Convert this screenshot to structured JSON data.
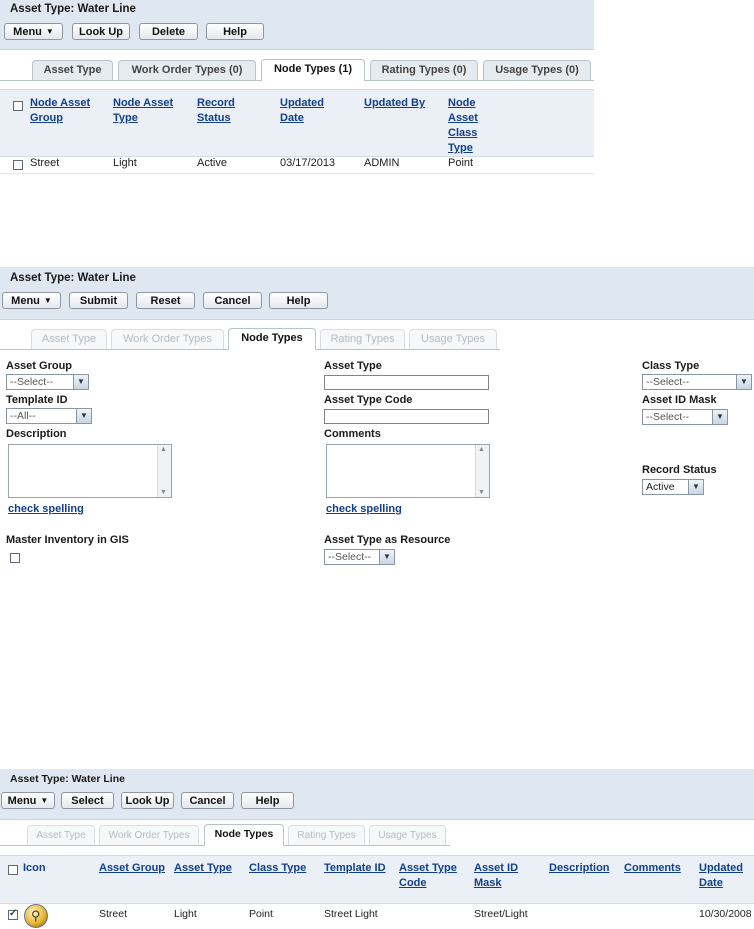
{
  "panel1": {
    "title": "Asset Type: Water Line",
    "buttons": {
      "menu": "Menu",
      "lookup": "Look Up",
      "delete": "Delete",
      "help": "Help"
    },
    "tabs": [
      "Asset Type",
      "Work Order Types (0)",
      "Node Types (1)",
      "Rating Types (0)",
      "Usage Types (0)"
    ],
    "active_tab": "Node Types (1)",
    "columns": {
      "c1": [
        "Node Asset",
        "Group"
      ],
      "c2": [
        "Node Asset",
        "Type"
      ],
      "c3": [
        "Record",
        "Status"
      ],
      "c4": [
        "Updated",
        "Date"
      ],
      "c5": [
        "Updated By"
      ],
      "c6": [
        "Node",
        "Asset",
        "Class",
        "Type"
      ]
    },
    "row": {
      "group": "Street",
      "type": "Light",
      "status": "Active",
      "date": "03/17/2013",
      "by": "ADMIN",
      "class": "Point"
    }
  },
  "panel2": {
    "title": "Asset Type: Water Line",
    "buttons": {
      "menu": "Menu",
      "submit": "Submit",
      "reset": "Reset",
      "cancel": "Cancel",
      "help": "Help"
    },
    "tabs": [
      "Asset Type",
      "Work Order Types",
      "Node Types",
      "Rating Types",
      "Usage Types"
    ],
    "active_tab": "Node Types",
    "fields": {
      "asset_group_label": "Asset Group",
      "asset_group_value": "--Select--",
      "template_id_label": "Template ID",
      "template_id_value": "--All--",
      "description_label": "Description",
      "check_spelling_1": "check spelling",
      "master_inventory_label": "Master Inventory in GIS",
      "asset_type_label": "Asset Type",
      "asset_type_code_label": "Asset Type Code",
      "comments_label": "Comments",
      "check_spelling_2": "check spelling",
      "asset_type_resource_label": "Asset Type as Resource",
      "asset_type_resource_value": "--Select--",
      "class_type_label": "Class Type",
      "class_type_value": "--Select--",
      "asset_id_mask_label": "Asset ID Mask",
      "asset_id_mask_value": "--Select--",
      "record_status_label": "Record Status",
      "record_status_value": "Active"
    }
  },
  "panel3": {
    "title": "Asset Type: Water Line",
    "buttons": {
      "menu": "Menu",
      "select": "Select",
      "lookup": "Look Up",
      "cancel": "Cancel",
      "help": "Help"
    },
    "tabs": [
      "Asset Type",
      "Work Order Types",
      "Node Types",
      "Rating Types",
      "Usage Types"
    ],
    "active_tab": "Node Types",
    "columns": {
      "icon": [
        "Icon"
      ],
      "group": [
        "Asset Group"
      ],
      "type": [
        "Asset Type"
      ],
      "class": [
        "Class Type"
      ],
      "template": [
        "Template ID"
      ],
      "code": [
        "Asset Type",
        "Code"
      ],
      "mask": [
        "Asset ID",
        "Mask"
      ],
      "desc": [
        "Description"
      ],
      "comments": [
        "Comments"
      ],
      "updated": [
        "Updated",
        "Date"
      ]
    },
    "row": {
      "group": "Street",
      "type": "Light",
      "class": "Point",
      "template": "Street Light",
      "mask": "Street/Light",
      "updated": "10/30/2008",
      "icon": "streetlight-icon"
    }
  }
}
